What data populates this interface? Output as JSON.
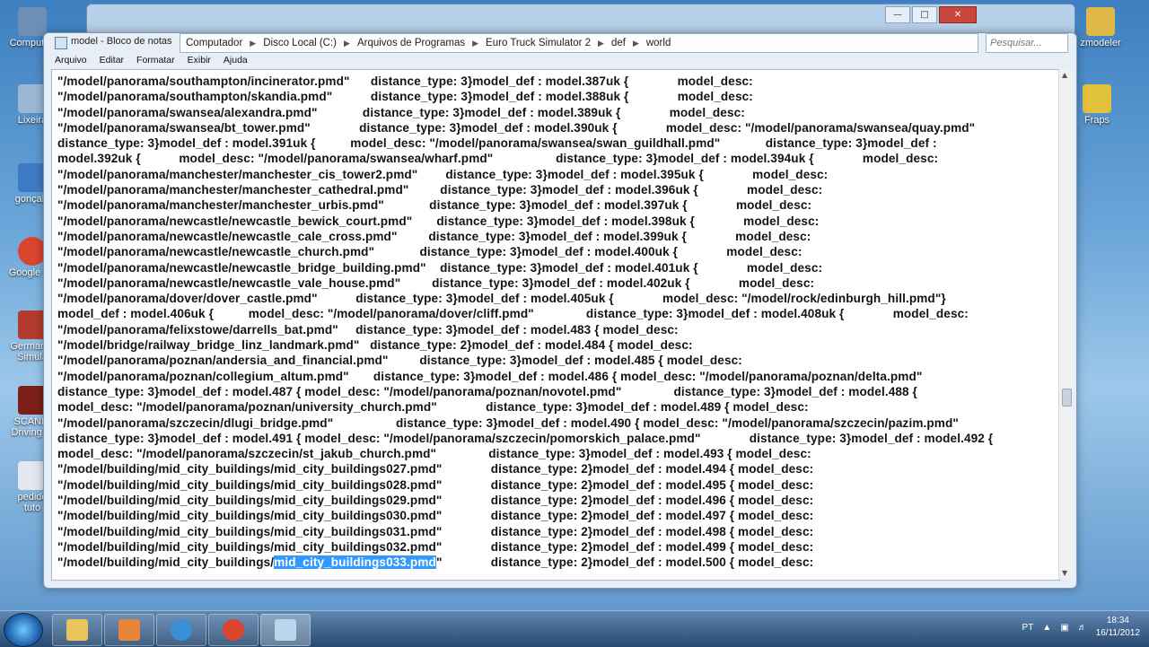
{
  "desktop": {
    "icons": [
      {
        "label": "Computad",
        "color": "#6d8fb5"
      },
      {
        "label": "Lixeira",
        "color": "#9bb8d3"
      },
      {
        "label": "gonçalo",
        "color": "#3f7bc4"
      },
      {
        "label": "Google Ch",
        "color": "#d9452f"
      },
      {
        "label": "German T\nSimula",
        "color": "#b33b2e"
      },
      {
        "label": "SCANIA\nDriving Si",
        "color": "#7c1f1a"
      },
      {
        "label": "pedido\ntuto",
        "color": "#e3e8ee"
      }
    ],
    "right_icons": [
      {
        "label": "zmodeler",
        "color": "#e0b84a"
      },
      {
        "label": "Fraps",
        "color": "#e2c23a"
      }
    ]
  },
  "explorer": {
    "path": [
      "Computador",
      "Disco Local (C:)",
      "Arquivos de Programas",
      "Euro Truck Simulator 2",
      "def",
      "world"
    ],
    "search_placeholder": "Pesquisar..."
  },
  "notepad": {
    "title": "model - Bloco de notas",
    "menu": [
      "Arquivo",
      "Editar",
      "Formatar",
      "Exibir",
      "Ajuda"
    ],
    "lines": [
      "\"/model/panorama/southampton/incinerator.pmd\"      distance_type: 3}model_def : model.387uk {              model_desc:",
      "\"/model/panorama/southampton/skandia.pmd\"           distance_type: 3}model_def : model.388uk {              model_desc:",
      "\"/model/panorama/swansea/alexandra.pmd\"             distance_type: 3}model_def : model.389uk {              model_desc:",
      "\"/model/panorama/swansea/bt_tower.pmd\"              distance_type: 3}model_def : model.390uk {              model_desc: \"/model/panorama/swansea/quay.pmd\"",
      "distance_type: 3}model_def : model.391uk {          model_desc: \"/model/panorama/swansea/swan_guildhall.pmd\"             distance_type: 3}model_def :",
      "model.392uk {           model_desc: \"/model/panorama/swansea/wharf.pmd\"                  distance_type: 3}model_def : model.394uk {              model_desc:",
      "\"/model/panorama/manchester/manchester_cis_tower2.pmd\"        distance_type: 3}model_def : model.395uk {              model_desc:",
      "\"/model/panorama/manchester/manchester_cathedral.pmd\"         distance_type: 3}model_def : model.396uk {              model_desc:",
      "\"/model/panorama/manchester/manchester_urbis.pmd\"             distance_type: 3}model_def : model.397uk {              model_desc:",
      "\"/model/panorama/newcastle/newcastle_bewick_court.pmd\"       distance_type: 3}model_def : model.398uk {              model_desc:",
      "\"/model/panorama/newcastle/newcastle_cale_cross.pmd\"         distance_type: 3}model_def : model.399uk {              model_desc:",
      "\"/model/panorama/newcastle/newcastle_church.pmd\"             distance_type: 3}model_def : model.400uk {              model_desc:",
      "\"/model/panorama/newcastle/newcastle_bridge_building.pmd\"    distance_type: 3}model_def : model.401uk {              model_desc:",
      "\"/model/panorama/newcastle/newcastle_vale_house.pmd\"         distance_type: 3}model_def : model.402uk {              model_desc:",
      "\"/model/panorama/dover/dover_castle.pmd\"           distance_type: 3}model_def : model.405uk {              model_desc: \"/model/rock/edinburgh_hill.pmd\"}",
      "model_def : model.406uk {          model_desc: \"/model/panorama/dover/cliff.pmd\"               distance_type: 3}model_def : model.408uk {              model_desc:",
      "\"/model/panorama/felixstowe/darrells_bat.pmd\"     distance_type: 3}model_def : model.483 { model_desc:",
      "\"/model/bridge/railway_bridge_linz_landmark.pmd\"   distance_type: 2}model_def : model.484 { model_desc:",
      "\"/model/panorama/poznan/andersia_and_financial.pmd\"         distance_type: 3}model_def : model.485 { model_desc:",
      "\"/model/panorama/poznan/collegium_altum.pmd\"       distance_type: 3}model_def : model.486 { model_desc: \"/model/panorama/poznan/delta.pmd\"",
      "distance_type: 3}model_def : model.487 { model_desc: \"/model/panorama/poznan/novotel.pmd\"               distance_type: 3}model_def : model.488 {",
      "model_desc: \"/model/panorama/poznan/university_church.pmd\"              distance_type: 3}model_def : model.489 { model_desc:",
      "\"/model/panorama/szczecin/dlugi_bridge.pmd\"                  distance_type: 3}model_def : model.490 { model_desc: \"/model/panorama/szczecin/pazim.pmd\"",
      "distance_type: 3}model_def : model.491 { model_desc: \"/model/panorama/szczecin/pomorskich_palace.pmd\"              distance_type: 3}model_def : model.492 {",
      "model_desc: \"/model/panorama/szczecin/st_jakub_church.pmd\"               distance_type: 3}model_def : model.493 { model_desc:",
      "\"/model/building/mid_city_buildings/mid_city_buildings027.pmd\"              distance_type: 2}model_def : model.494 { model_desc:",
      "\"/model/building/mid_city_buildings/mid_city_buildings028.pmd\"              distance_type: 2}model_def : model.495 { model_desc:",
      "\"/model/building/mid_city_buildings/mid_city_buildings029.pmd\"              distance_type: 2}model_def : model.496 { model_desc:",
      "\"/model/building/mid_city_buildings/mid_city_buildings030.pmd\"              distance_type: 2}model_def : model.497 { model_desc:",
      "\"/model/building/mid_city_buildings/mid_city_buildings031.pmd\"              distance_type: 2}model_def : model.498 { model_desc:",
      "\"/model/building/mid_city_buildings/mid_city_buildings032.pmd\"              distance_type: 2}model_def : model.499 { model_desc:"
    ],
    "last_line": {
      "before": "\"/model/building/mid_city_buildings/",
      "selected": "mid_city_buildings033.pmd",
      "after": "\"              distance_type: 2}model_def : model.500 { model_desc:"
    }
  },
  "taskbar": {
    "language": "PT",
    "time": "18:34",
    "date": "16/11/2012",
    "apps": [
      {
        "name": "explorer",
        "color": "#e8c45a"
      },
      {
        "name": "media",
        "color": "#e5863a"
      },
      {
        "name": "ie",
        "color": "#3a8fd9"
      },
      {
        "name": "chrome",
        "color": "#d9452f"
      },
      {
        "name": "notepad",
        "color": "#bcd6ee"
      }
    ]
  }
}
